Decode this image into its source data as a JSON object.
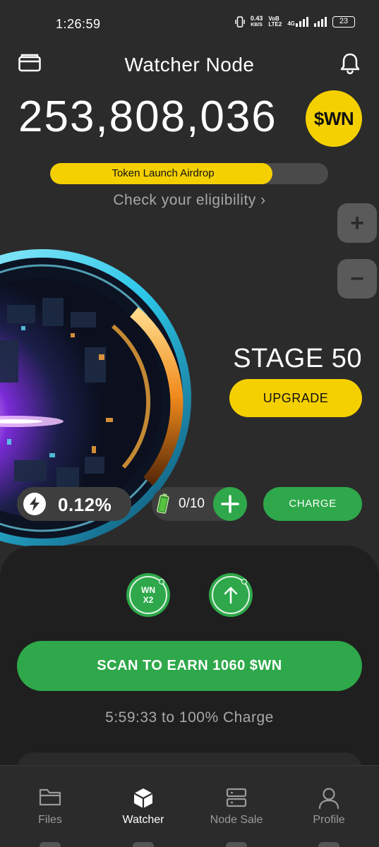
{
  "status_bar": {
    "time": "1:26:59",
    "speed_value": "0.43",
    "speed_unit": "KB/S",
    "volte_top": "VoB",
    "volte_bottom": "LTE2",
    "network": "4G",
    "battery": "23"
  },
  "header": {
    "title": "Watcher Node",
    "left_icon": "wallet-icon",
    "right_icon": "bell-icon"
  },
  "balance": {
    "amount": "253,808,036",
    "token_symbol": "$WN"
  },
  "airdrop": {
    "label": "Token Launch Airdrop",
    "progress": 0.8,
    "link_text": "Check your eligibility ›"
  },
  "zoom": {
    "zoom_in": "+",
    "zoom_out": "−"
  },
  "node": {
    "stage_label": "STAGE 50",
    "upgrade_label": "UPGRADE"
  },
  "stats": {
    "rate": "0.12%",
    "batteries": "0/10",
    "charge_label": "CHARGE"
  },
  "boosts": {
    "multiplier_line1": "WN",
    "multiplier_line2": "X2",
    "upgrade_icon": "arrow-up-icon"
  },
  "scan": {
    "label": "SCAN TO EARN 1060 $WN",
    "timer": "5:59:33 to 100% Charge"
  },
  "nav": {
    "items": [
      {
        "label": "Files",
        "icon": "folder-icon",
        "active": false
      },
      {
        "label": "Watcher",
        "icon": "cube-icon",
        "active": true
      },
      {
        "label": "Node Sale",
        "icon": "server-icon",
        "active": false
      },
      {
        "label": "Profile",
        "icon": "user-icon",
        "active": false
      }
    ]
  },
  "colors": {
    "background": "#2b2b2b",
    "accent_yellow": "#f5d000",
    "accent_green": "#2ea84a",
    "panel": "#1f1f1f"
  }
}
